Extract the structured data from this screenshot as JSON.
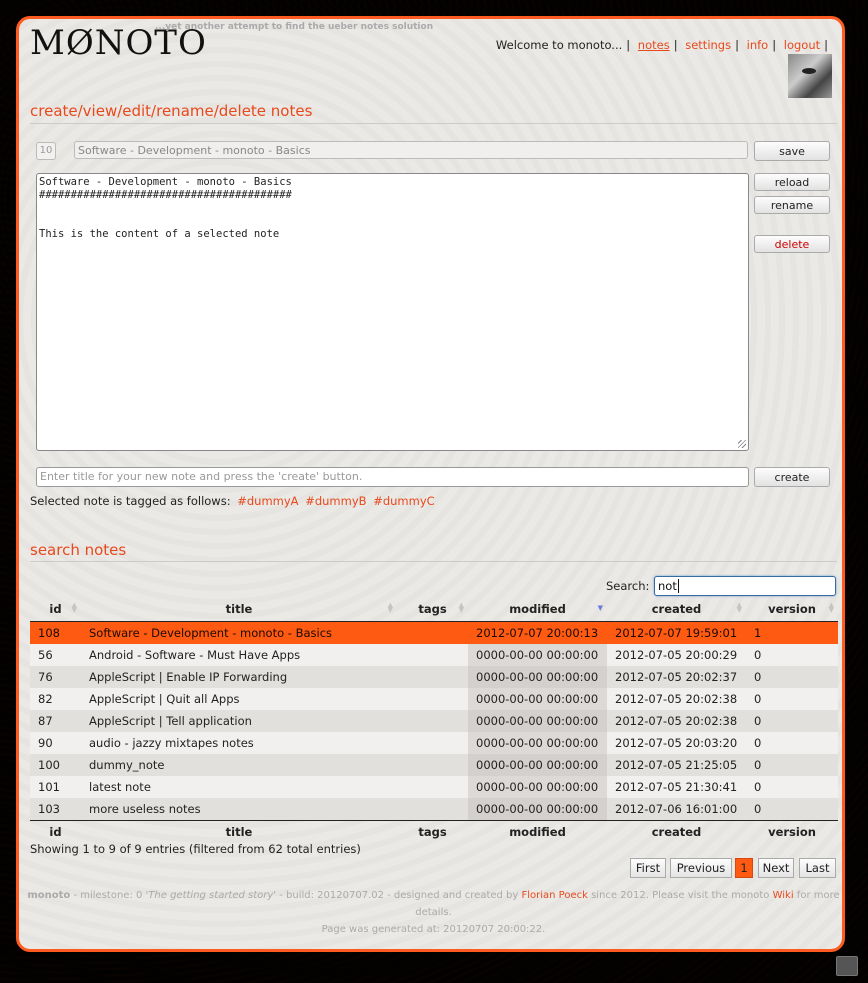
{
  "header": {
    "logo": "MØNOTO",
    "tagline": "...yet another attempt to find the ueber notes solution",
    "welcome": "Welcome to monoto...",
    "nav": [
      {
        "label": "notes"
      },
      {
        "label": "settings"
      },
      {
        "label": "info"
      },
      {
        "label": "logout"
      }
    ]
  },
  "notes_section": {
    "title": "create/view/edit/rename/delete notes",
    "note_id": "10",
    "note_title": "Software - Development - monoto - Basics",
    "content": "Software - Development - monoto - Basics\n########################################\n\n\nThis is the content of a selected note",
    "buttons": {
      "save": "save",
      "reload": "reload",
      "rename": "rename",
      "delete": "delete",
      "create": "create"
    },
    "new_title_placeholder": "Enter title for your new note and press the 'create' button.",
    "tags_label": "Selected note is tagged as follows:",
    "tags": [
      "#dummyA",
      "#dummyB",
      "#dummyC"
    ]
  },
  "search_section": {
    "title": "search notes",
    "search_label": "Search:",
    "search_value": "not",
    "columns": [
      "id",
      "title",
      "tags",
      "modified",
      "created",
      "version"
    ],
    "rows": [
      {
        "id": "108",
        "title": "Software - Development - monoto - Basics",
        "tags": "",
        "modified": "2012-07-07 20:00:13",
        "created": "2012-07-07 19:59:01",
        "version": "1"
      },
      {
        "id": "56",
        "title": "Android - Software - Must Have Apps",
        "tags": "",
        "modified": "0000-00-00 00:00:00",
        "created": "2012-07-05 20:00:29",
        "version": "0"
      },
      {
        "id": "76",
        "title": "AppleScript | Enable IP Forwarding",
        "tags": "",
        "modified": "0000-00-00 00:00:00",
        "created": "2012-07-05 20:02:37",
        "version": "0"
      },
      {
        "id": "82",
        "title": "AppleScript | Quit all Apps",
        "tags": "",
        "modified": "0000-00-00 00:00:00",
        "created": "2012-07-05 20:02:38",
        "version": "0"
      },
      {
        "id": "87",
        "title": "AppleScript | Tell application",
        "tags": "",
        "modified": "0000-00-00 00:00:00",
        "created": "2012-07-05 20:02:38",
        "version": "0"
      },
      {
        "id": "90",
        "title": "audio - jazzy mixtapes notes",
        "tags": "",
        "modified": "0000-00-00 00:00:00",
        "created": "2012-07-05 20:03:20",
        "version": "0"
      },
      {
        "id": "100",
        "title": "dummy_note",
        "tags": "",
        "modified": "0000-00-00 00:00:00",
        "created": "2012-07-05 21:25:05",
        "version": "0"
      },
      {
        "id": "101",
        "title": "latest note",
        "tags": "",
        "modified": "0000-00-00 00:00:00",
        "created": "2012-07-05 21:30:41",
        "version": "0"
      },
      {
        "id": "103",
        "title": "more useless notes",
        "tags": "",
        "modified": "0000-00-00 00:00:00",
        "created": "2012-07-06 16:01:00",
        "version": "0"
      }
    ],
    "info": "Showing 1 to 9 of 9 entries (filtered from 62 total entries)",
    "pagination": {
      "first": "First",
      "previous": "Previous",
      "current": "1",
      "next": "Next",
      "last": "Last"
    }
  },
  "footer": {
    "app": "monoto",
    "milestone_pre": " - milestone: 0 '",
    "milestone_name": "The getting started story",
    "build": "' - build: 20120707.02 - designed and created by ",
    "author": "Florian Poeck",
    "since": " since 2012. Please visit the monoto ",
    "wiki": "Wiki",
    "more": " for more details.",
    "generated": "Page was generated at: 20120707 20:00:22."
  },
  "colors": {
    "accent": "#ff5a12",
    "link": "#e8491c"
  }
}
